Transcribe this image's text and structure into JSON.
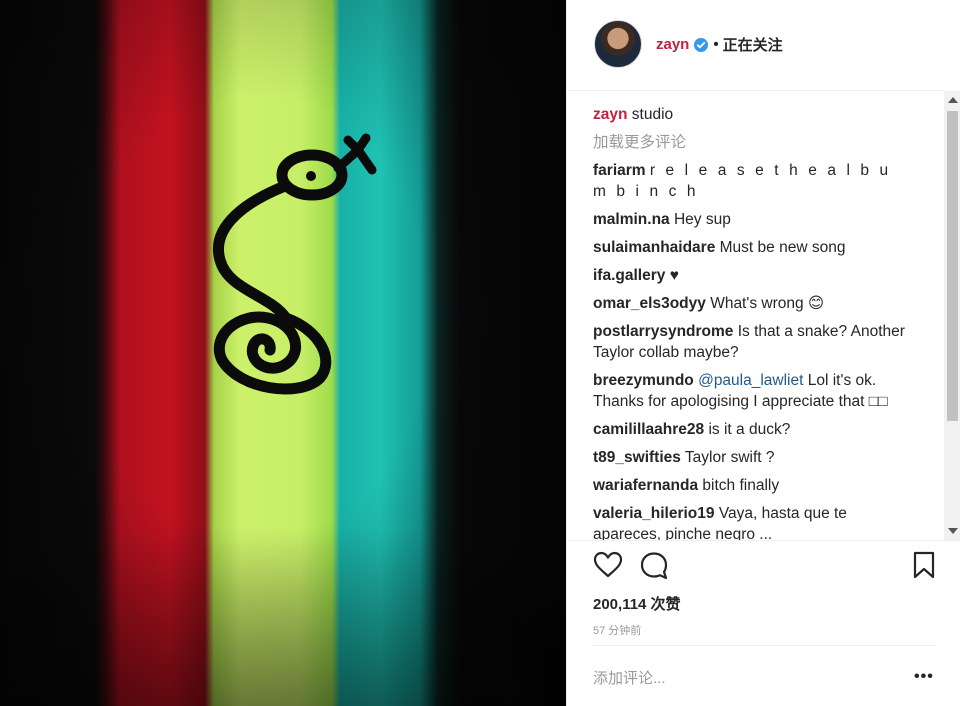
{
  "post": {
    "username": "zayn",
    "verified": true,
    "follow_status": "正在关注",
    "separator": "•"
  },
  "comments": {
    "caption": {
      "user": "zayn",
      "text": "studio"
    },
    "load_more": "加载更多评论",
    "items": [
      {
        "user": "fariarm",
        "text": "r e l e a s e t h e a l b u m b i n c h"
      },
      {
        "user": "malmin.na",
        "text": "Hey sup"
      },
      {
        "user": "sulaimanhaidare",
        "text": "Must be new song"
      },
      {
        "user": "ifa.gallery",
        "text": "♥"
      },
      {
        "user": "omar_els3odyy",
        "text": "What's wrong 😊"
      },
      {
        "user": "postlarrysyndrome",
        "text": "Is that a snake? Another Taylor collab maybe?"
      },
      {
        "user": "breezymundo",
        "mention": "@paula_lawliet",
        "text": "Lol it's ok. Thanks for apologising I appreciate that □□"
      },
      {
        "user": "camilillaahre28",
        "text": "is it a duck?"
      },
      {
        "user": "t89_swifties",
        "text": "Taylor swift ?"
      },
      {
        "user": "wariafernanda",
        "text": "bitch finally"
      },
      {
        "user": "valeria_hilerio19",
        "text": "Vaya, hasta que te apareces, pinche negro ..."
      }
    ]
  },
  "actions": {
    "like_icon": "heart-icon",
    "comment_icon": "comment-bubble-icon",
    "save_icon": "bookmark-icon"
  },
  "likes_text": "200,114 次赞",
  "time_text": "57 分钟前",
  "add_comment_placeholder": "添加评论...",
  "more_options": "•••",
  "colors": {
    "username_accent": "#c4223a",
    "mention": "#1f5a8a",
    "muted": "#999999"
  }
}
